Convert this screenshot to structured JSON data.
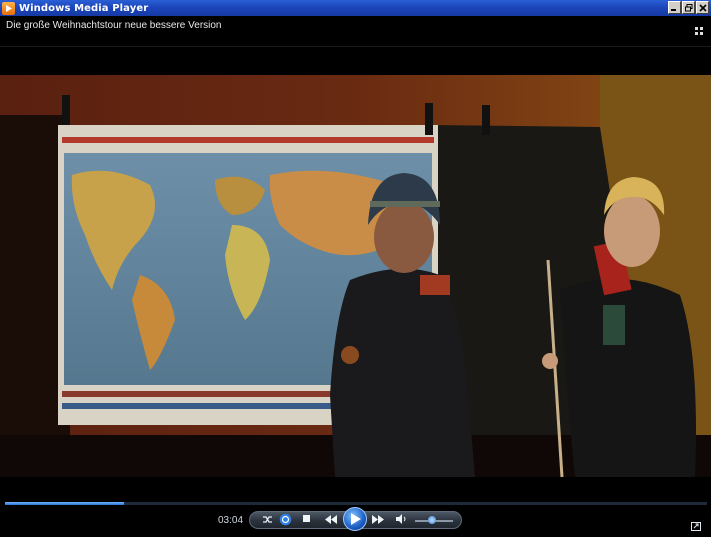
{
  "window": {
    "title": "Windows Media Player",
    "buttons": {
      "minimize": "_",
      "restore": "▫",
      "close": "X"
    }
  },
  "media": {
    "title": "Die große Weihnachtstour neue bessere Version"
  },
  "video": {
    "description_icon": "video-frame"
  },
  "playback": {
    "elapsed": "03:04",
    "progress_fraction": 0.17,
    "volume_fraction": 0.45
  },
  "controls": {
    "shuffle_icon": "shuffle-icon",
    "repeat_icon": "repeat-icon",
    "stop_icon": "stop-icon",
    "previous_icon": "previous-icon",
    "play_icon": "play-icon",
    "next_icon": "next-icon",
    "mute_icon": "speaker-icon",
    "fullscreen_icon": "fullscreen-icon"
  },
  "colors": {
    "titlebar": "#1b44b8",
    "accent": "#2b74d6"
  }
}
